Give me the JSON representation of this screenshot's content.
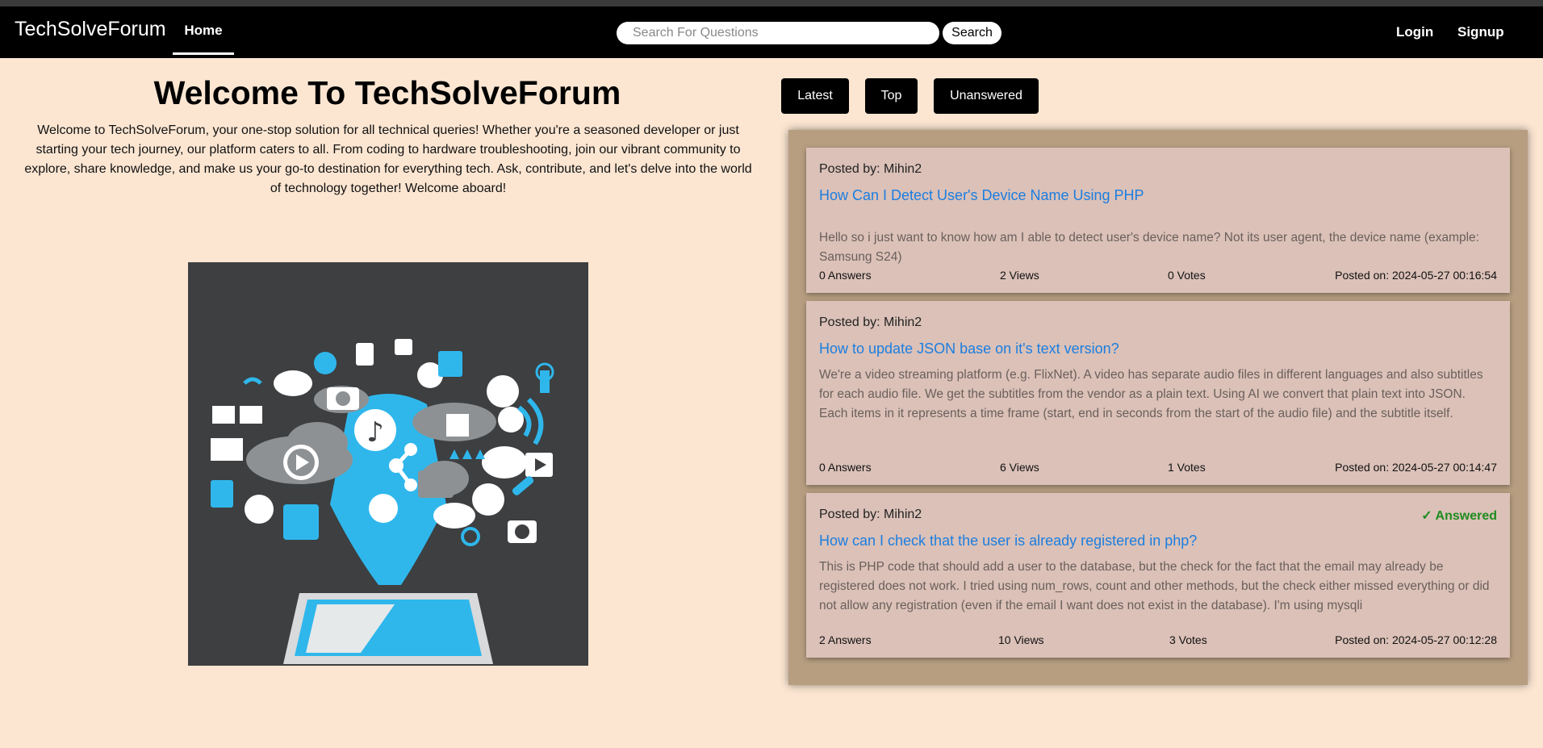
{
  "header": {
    "brand": "TechSolveForum",
    "nav_home": "Home",
    "search_placeholder": "Search For Questions",
    "search_button": "Search",
    "login": "Login",
    "signup": "Signup"
  },
  "welcome": {
    "title": "Welcome To TechSolveForum",
    "text": "Welcome to TechSolveForum, your one-stop solution for all technical queries! Whether you're a seasoned developer or just starting your tech journey, our platform caters to all. From coding to hardware troubleshooting, join our vibrant community to explore, share knowledge, and make us your go-to destination for everything tech. Ask, contribute, and let's delve into the world of technology together! Welcome aboard!"
  },
  "filters": [
    "Latest",
    "Top",
    "Unanswered"
  ],
  "questions": [
    {
      "posted_by": "Posted by: Mihin2",
      "title": "How Can I Detect User's Device Name Using PHP",
      "body": "Hello so i just want to know how am I able to detect user's device name? Not its user agent, the device name (example: Samsung S24)",
      "answers": "0 Answers",
      "views": "2 Views",
      "votes": "0 Votes",
      "posted_on": "Posted on: 2024-05-27 00:16:54",
      "answered": ""
    },
    {
      "posted_by": "Posted by: Mihin2",
      "title": "How to update JSON base on it's text version?",
      "body": "We're a video streaming platform (e.g. FlixNet). A video has separate audio files in different languages and also subtitles for each audio file. We get the subtitles from the vendor as a plain text. Using AI we convert that plain text into JSON. Each items in it represents a time frame (start, end in seconds from the start of the audio file) and the subtitle itself.",
      "answers": "0 Answers",
      "views": "6 Views",
      "votes": "1 Votes",
      "posted_on": "Posted on: 2024-05-27 00:14:47",
      "answered": ""
    },
    {
      "posted_by": "Posted by: Mihin2",
      "title": "How can I check that the user is already registered in php?",
      "body": "This is PHP code that should add a user to the database, but the check for the fact that the email may already be registered does not work. I tried using num_rows, count and other methods, but the check either missed everything or did not allow any registration (even if the email I want does not exist in the database). I'm using mysqli",
      "answers": "2 Answers",
      "views": "10 Views",
      "votes": "3 Votes",
      "posted_on": "Posted on: 2024-05-27 00:12:28",
      "answered": "✓ Answered"
    }
  ],
  "colors": {
    "page_bg": "#fce6d2",
    "navbar_bg": "#000000",
    "panel_bg": "#b79e81",
    "card_bg": "#dbc1b8",
    "link": "#1c7ee0",
    "answered": "#1e8c1e",
    "illustration_bg": "#3d3f41",
    "illustration_accent": "#2fb7ec"
  },
  "illustration": {
    "icon": "tech-cloud-illustration-icon"
  }
}
